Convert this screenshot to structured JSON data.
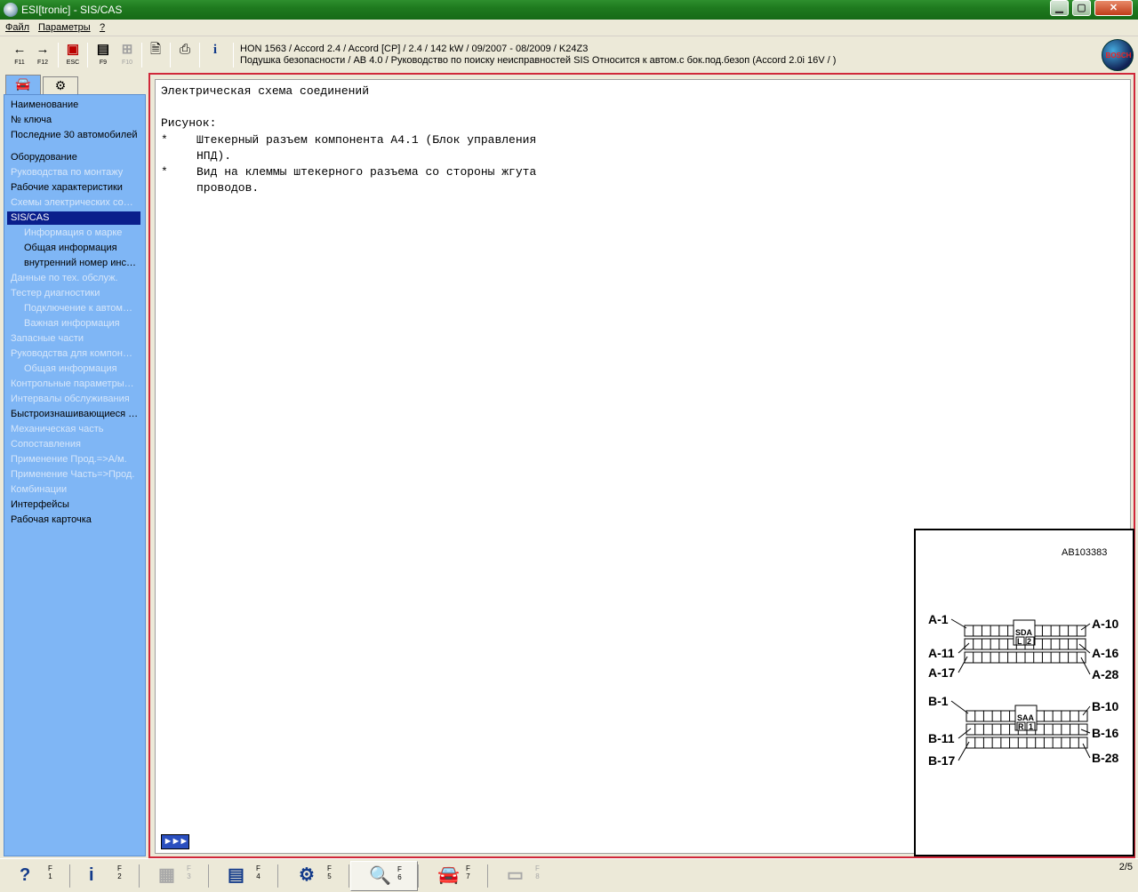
{
  "window": {
    "title": "ESI[tronic] - SIS/CAS",
    "minimize": "▁",
    "maximize": "▢",
    "close": "✕"
  },
  "menu": {
    "file": "Файл",
    "params": "Параметры",
    "help": "?"
  },
  "toolbar": {
    "back_key": "F11",
    "forward_key": "F12",
    "esc_key": "ESC",
    "f9_key": "F9",
    "f10_key": "F10"
  },
  "vehicle": {
    "line1": "HON 1563 / Accord 2.4 / Accord [CP] / 2.4 / 142 kW / 09/2007 - 08/2009 / K24Z3",
    "line2": "Подушка безопасности / AB 4.0 / Руководство по поиску неисправностей SIS Относится к автом.с бок.под.безоп  (Accord 2.0i 16V  / )"
  },
  "bosch": "BOSCH",
  "sidebar": {
    "items": [
      {
        "label": "Наименование",
        "state": "normal",
        "indent": false
      },
      {
        "label": "№ ключа",
        "state": "normal",
        "indent": false
      },
      {
        "label": "Последние 30 автомобилей",
        "state": "normal",
        "indent": false
      },
      {
        "label": "Оборудование",
        "state": "normal",
        "indent": false
      },
      {
        "label": "Руководства по монтажу",
        "state": "disabled",
        "indent": false
      },
      {
        "label": "Рабочие характеристики",
        "state": "normal",
        "indent": false
      },
      {
        "label": "Схемы электрических со…",
        "state": "disabled",
        "indent": false
      },
      {
        "label": "SIS/CAS",
        "state": "selected",
        "indent": false
      },
      {
        "label": "Информация о марке",
        "state": "disabled",
        "indent": true
      },
      {
        "label": "Общая информация",
        "state": "normal",
        "indent": true
      },
      {
        "label": "внутренний номер инс…",
        "state": "normal",
        "indent": true
      },
      {
        "label": "Данные по тех. обслуж.",
        "state": "disabled",
        "indent": false
      },
      {
        "label": "Тестер диагностики",
        "state": "disabled",
        "indent": false
      },
      {
        "label": "Подключение к автом…",
        "state": "disabled",
        "indent": true
      },
      {
        "label": "Важная информация",
        "state": "disabled",
        "indent": true
      },
      {
        "label": "Запасные части",
        "state": "disabled",
        "indent": false
      },
      {
        "label": "Руководства для компон…",
        "state": "disabled",
        "indent": false
      },
      {
        "label": "Общая информация",
        "state": "disabled",
        "indent": true
      },
      {
        "label": "Контрольные параметры…",
        "state": "disabled",
        "indent": false
      },
      {
        "label": "Интервалы обслуживания",
        "state": "disabled",
        "indent": false
      },
      {
        "label": "Быстроизнашивающиеся …",
        "state": "normal",
        "indent": false
      },
      {
        "label": "Механическая часть",
        "state": "disabled",
        "indent": false
      },
      {
        "label": "Сопоставления",
        "state": "disabled",
        "indent": false
      },
      {
        "label": "Применение Прод.=>А/м.",
        "state": "disabled",
        "indent": false
      },
      {
        "label": "Применение Часть=>Прод.",
        "state": "disabled",
        "indent": false
      },
      {
        "label": "Комбинации",
        "state": "disabled",
        "indent": false
      },
      {
        "label": "Интерфейсы",
        "state": "normal",
        "indent": false
      },
      {
        "label": "Рабочая карточка",
        "state": "normal",
        "indent": false
      }
    ]
  },
  "document": {
    "title": "Электрическая схема соединений",
    "figure_label": "Рисунок:",
    "bullet_char": "*",
    "bullets": [
      "Штекерный разъем компонента A4.1 (Блок управления НПД).",
      "Вид на клеммы штекерного разъема со стороны жгута проводов."
    ],
    "next_button": "►►►"
  },
  "diagram": {
    "ref": "AB103383",
    "connector_a": {
      "code": "SDA",
      "mark_left": "L",
      "mark_right": "2",
      "labels": {
        "tl": "A-1",
        "tr": "A-10",
        "ml": "A-11",
        "mr": "A-16",
        "bl": "A-17",
        "br": "A-28"
      }
    },
    "connector_b": {
      "code": "SAA",
      "mark_left": "R",
      "mark_right": "1",
      "labels": {
        "tl": "B-1",
        "tr": "B-10",
        "ml": "B-11",
        "mr": "B-16",
        "bl": "B-17",
        "br": "B-28"
      }
    }
  },
  "statusbar": {
    "buttons": [
      {
        "icon": "?",
        "key": "F\n1",
        "name": "help",
        "disabled": false,
        "pressed": false
      },
      {
        "icon": "i",
        "key": "F\n2",
        "name": "info",
        "disabled": false,
        "pressed": false
      },
      {
        "icon": "▦",
        "key": "F\n3",
        "name": "list",
        "disabled": true,
        "pressed": false
      },
      {
        "icon": "▤",
        "key": "F\n4",
        "name": "schematic",
        "disabled": false,
        "pressed": false
      },
      {
        "icon": "⚙",
        "key": "F\n5",
        "name": "component",
        "disabled": false,
        "pressed": false
      },
      {
        "icon": "🔍",
        "key": "F\n6",
        "name": "zoom",
        "disabled": false,
        "pressed": true
      },
      {
        "icon": "🚘",
        "key": "F\n7",
        "name": "vehicle",
        "disabled": false,
        "pressed": false
      },
      {
        "icon": "▭",
        "key": "F\n8",
        "name": "export",
        "disabled": true,
        "pressed": false
      }
    ],
    "page": "2/5"
  }
}
